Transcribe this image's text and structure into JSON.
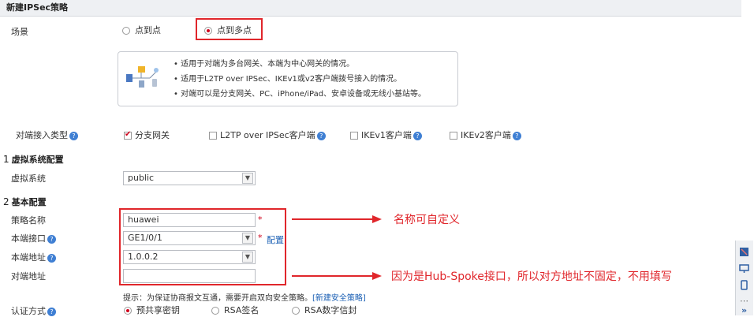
{
  "header": {
    "title": "新建IPSec策略"
  },
  "scenario": {
    "label": "场景",
    "options": [
      {
        "label": "点到点",
        "selected": false
      },
      {
        "label": "点到多点",
        "selected": true
      }
    ],
    "info_lines": [
      "适用于对端为多台网关、本端为中心网关的情况。",
      "适用于L2TP over IPSec、IKEv1或v2客户端拨号接入的情况。",
      "对端可以是分支网关、PC、iPhone/iPad、安卓设备或无线小基站等。"
    ]
  },
  "peer_access": {
    "label": "对端接入类型",
    "options": [
      {
        "label": "分支网关",
        "checked": true
      },
      {
        "label": "L2TP over IPSec客户端",
        "checked": false
      },
      {
        "label": "IKEv1客户端",
        "checked": false
      },
      {
        "label": "IKEv2客户端",
        "checked": false
      }
    ]
  },
  "section1": {
    "num": "1",
    "title": "虚拟系统配置"
  },
  "vsys": {
    "label": "虚拟系统",
    "value": "public"
  },
  "section2": {
    "num": "2",
    "title": "基本配置"
  },
  "policy_name": {
    "label": "策略名称",
    "value": "huawei"
  },
  "local_interface": {
    "label": "本端接口",
    "value": "GE1/0/1",
    "config_link": "配置"
  },
  "local_address": {
    "label": "本端地址",
    "value": "1.0.0.2"
  },
  "peer_address": {
    "label": "对端地址",
    "value": ""
  },
  "hint": {
    "text": "提示：为保证协商报文互通，需要开启双向安全策略。",
    "link": "[新建安全策略]"
  },
  "auth": {
    "label": "认证方式",
    "options": [
      {
        "label": "预共享密钥",
        "selected": true
      },
      {
        "label": "RSA签名",
        "selected": false
      },
      {
        "label": "RSA数字信封",
        "selected": false
      }
    ]
  },
  "annotations": {
    "name_note": "名称可自定义",
    "peer_note": "因为是Hub-Spoke接口，所以对方地址不固定，不用填写"
  },
  "required_mark": "*",
  "help_mark": "?",
  "colors": {
    "annotation": "#e0262b",
    "help": "#3f7fd3",
    "link": "#1a5fb4"
  }
}
